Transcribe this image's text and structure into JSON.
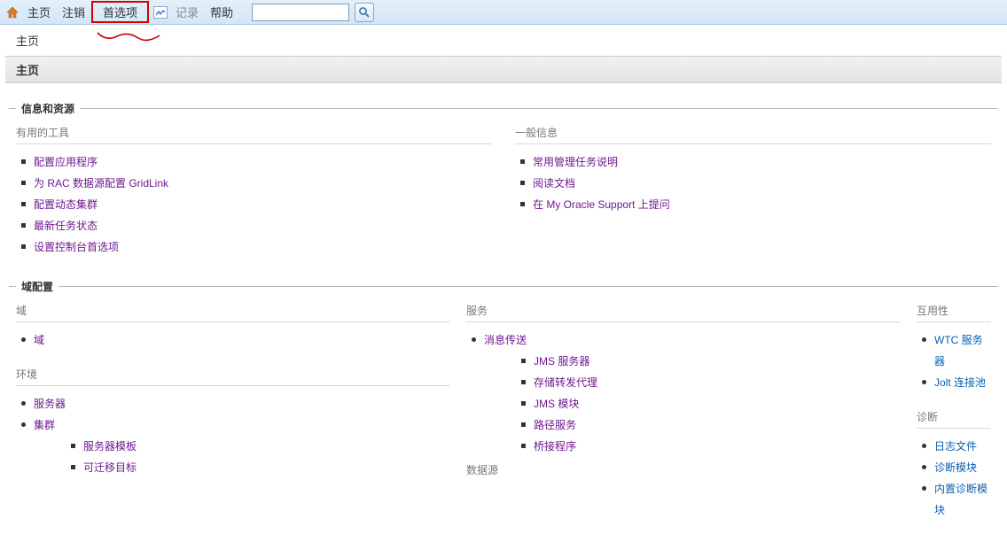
{
  "toolbar": {
    "home": "主页",
    "logout": "注销",
    "prefs": "首选项",
    "record": "记录",
    "help": "帮助",
    "search_placeholder": ""
  },
  "breadcrumb": {
    "home": "主页"
  },
  "page_title": "主页",
  "sections": {
    "info": {
      "legend": "信息和资源",
      "tools_head": "有用的工具",
      "tools": [
        "配置应用程序",
        "为 RAC 数据源配置 GridLink",
        "配置动态集群",
        "最新任务状态",
        "设置控制台首选项"
      ],
      "general_head": "一般信息",
      "general": [
        "常用管理任务说明",
        "阅读文档",
        "在 My Oracle Support 上提问"
      ]
    },
    "domain": {
      "legend": "域配置",
      "col1": {
        "domain_head": "域",
        "domain_items": [
          "域"
        ],
        "env_head": "环境",
        "env_items": [
          "服务器",
          "集群"
        ],
        "env_sub": [
          "服务器模板",
          "可迁移目标"
        ]
      },
      "col2": {
        "svc_head": "服务",
        "svc_items": [
          "消息传送"
        ],
        "svc_sub": [
          "JMS 服务器",
          "存储转发代理",
          "JMS 模块",
          "路径服务",
          "桥接程序"
        ],
        "ds_head": "数据源"
      },
      "col3": {
        "interop_head": "互用性",
        "interop_items": [
          "WTC 服务器",
          "Jolt 连接池"
        ],
        "diag_head": "诊断",
        "diag_items": [
          "日志文件",
          "诊断模块",
          "内置诊断模块"
        ]
      }
    }
  }
}
